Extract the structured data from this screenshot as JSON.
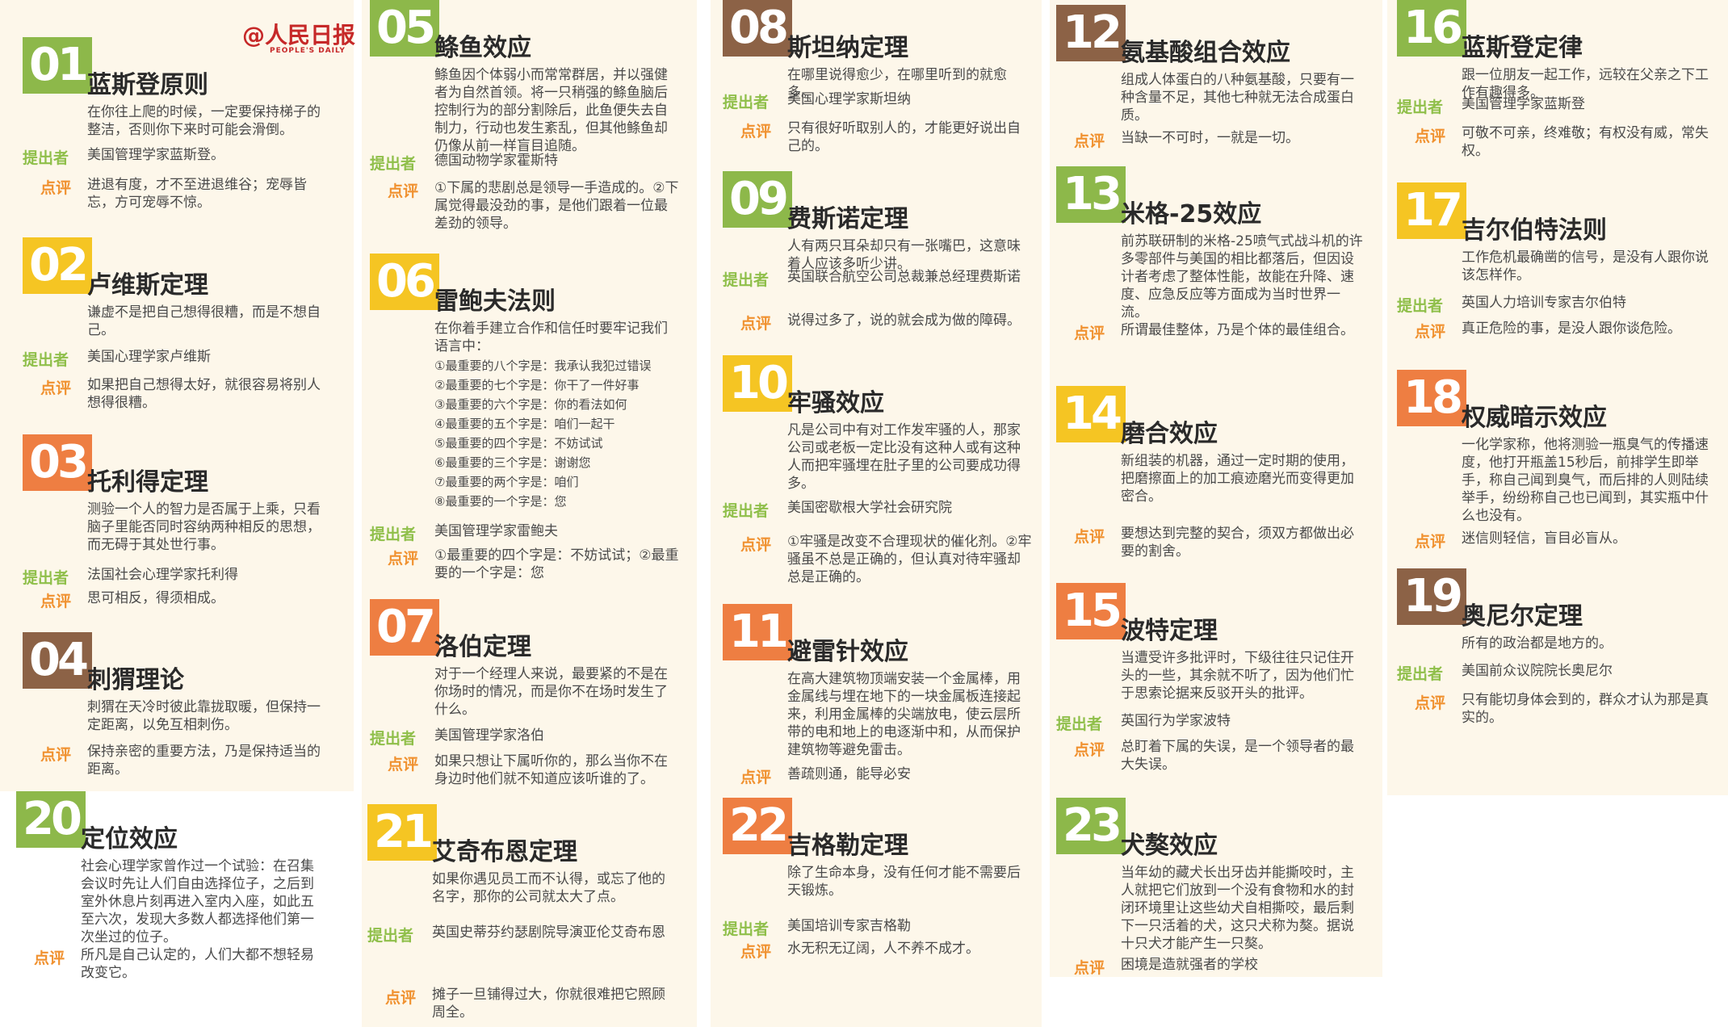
{
  "brand": {
    "logo": "@人民日报",
    "sub": "PEOPLE'S DAILY"
  },
  "colors": {
    "green": "#8db84a",
    "yellow": "#f5c523",
    "orange": "#ee7e42",
    "brown": "#8c6246",
    "label_orange": "#f0912f",
    "label_green": "#8fbf4a"
  },
  "labels": {
    "proposer": "提出者",
    "comment": "点评"
  },
  "laws": [
    {
      "num": "01",
      "title": "蓝斯登原则",
      "desc": "在你往上爬的时候，一定要保持梯子的整洁，否则你下来时可能会滑倒。",
      "proposer": "美国管理学家蓝斯登。",
      "comment": "进退有度，才不至进退维谷；宠辱皆忘，方可宠辱不惊。"
    },
    {
      "num": "02",
      "title": "卢维斯定理",
      "desc": "谦虚不是把自己想得很糟，而是不想自己。",
      "proposer": "美国心理学家卢维斯",
      "comment": "如果把自己想得太好，就很容易将别人想得很糟。"
    },
    {
      "num": "03",
      "title": "托利得定理",
      "desc": "测验一个人的智力是否属于上乘，只看脑子里能否同时容纳两种相反的思想，而无碍于其处世行事。",
      "proposer": "法国社会心理学家托利得",
      "comment": "思可相反，得须相成。"
    },
    {
      "num": "04",
      "title": "刺猬理论",
      "desc": "刺猬在天冷时彼此靠拢取暖，但保持一定距离，以免互相刺伤。",
      "proposer": "",
      "comment": "保持亲密的重要方法，乃是保持适当的距离。"
    },
    {
      "num": "05",
      "title": "鲦鱼效应",
      "desc": "鲦鱼因个体弱小而常常群居，并以强健者为自然首领。将一只稍强的鲦鱼脑后控制行为的部分割除后，此鱼便失去自制力，行动也发生紊乱，但其他鲦鱼却仍像从前一样盲目追随。",
      "proposer": "德国动物学家霍斯特",
      "comment": "①下属的悲剧总是领导一手造成的。②下属觉得最没劲的事，是他们跟着一位最差劲的领导。"
    },
    {
      "num": "06",
      "title": "雷鲍夫法则",
      "desc": "在你着手建立合作和信任时要牢记我们语言中：",
      "list": [
        "①最重要的八个字是：我承认我犯过错误",
        "②最重要的七个字是：你干了一件好事",
        "③最重要的六个字是：你的看法如何",
        "④最重要的五个字是：咱们一起干",
        "⑤最重要的四个字是：不妨试试",
        "⑥最重要的三个字是：谢谢您",
        "⑦最重要的两个字是：咱们",
        "⑧最重要的一个字是：您"
      ],
      "proposer": "美国管理学家雷鲍夫",
      "comment": "①最重要的四个字是：不妨试试；②最重要的一个字是：您"
    },
    {
      "num": "07",
      "title": "洛伯定理",
      "desc": "对于一个经理人来说，最要紧的不是在你场时的情况，而是你不在场时发生了什么。",
      "proposer": "美国管理学家洛伯",
      "comment": "如果只想让下属听你的，那么当你不在身边时他们就不知道应该听谁的了。"
    },
    {
      "num": "08",
      "title": "斯坦纳定理",
      "desc": "在哪里说得愈少，在哪里听到的就愈多。",
      "proposer": "美国心理学家斯坦纳",
      "comment": "只有很好听取别人的，才能更好说出自己的。"
    },
    {
      "num": "09",
      "title": "费斯诺定理",
      "desc": "人有两只耳朵却只有一张嘴巴，这意味着人应该多听少讲。",
      "proposer": "英国联合航空公司总裁兼总经理费斯诺",
      "comment": "说得过多了，说的就会成为做的障碍。"
    },
    {
      "num": "10",
      "title": "牢骚效应",
      "desc": "凡是公司中有对工作发牢骚的人，那家公司或老板一定比没有这种人或有这种人而把牢骚埋在肚子里的公司要成功得多。",
      "proposer": "美国密歇根大学社会研究院",
      "comment": "①牢骚是改变不合理现状的催化剂。②牢骚虽不总是正确的，但认真对待牢骚却总是正确的。"
    },
    {
      "num": "11",
      "title": "避雷针效应",
      "desc": "在高大建筑物顶端安装一个金属棒，用金属线与埋在地下的一块金属板连接起来，利用金属棒的尖端放电，使云层所带的电和地上的电逐渐中和，从而保护建筑物等避免雷击。",
      "proposer": "",
      "comment": "善疏则通，能导必安"
    },
    {
      "num": "12",
      "title": "氨基酸组合效应",
      "desc": "组成人体蛋白的八种氨基酸，只要有一种含量不足，其他七种就无法合成蛋白质。",
      "proposer": "",
      "comment": "当缺一不可时，一就是一切。"
    },
    {
      "num": "13",
      "title": "米格-25效应",
      "desc": "前苏联研制的米格-25喷气式战斗机的许多零部件与美国的相比都落后，但因设计者考虑了整体性能，故能在升降、速度、应急反应等方面成为当时世界一流。",
      "proposer": "",
      "comment": "所谓最佳整体，乃是个体的最佳组合。"
    },
    {
      "num": "14",
      "title": "磨合效应",
      "desc": "新组装的机器，通过一定时期的使用，把磨擦面上的加工痕迹磨光而变得更加密合。",
      "proposer": "",
      "comment": "要想达到完整的契合，须双方都做出必要的割舍。"
    },
    {
      "num": "15",
      "title": "波特定理",
      "desc": "当遭受许多批评时，下级往往只记住开头的一些，其余就不听了，因为他们忙于思索论据来反驳开头的批评。",
      "proposer": "英国行为学家波特",
      "comment": "总盯着下属的失误，是一个领导者的最大失误。"
    },
    {
      "num": "16",
      "title": "蓝斯登定律",
      "desc": "跟一位朋友一起工作，远较在父亲之下工作有趣得多。",
      "proposer": "美国管理学家蓝斯登",
      "comment": "可敬不可亲，终难敬；有权没有威，常失权。"
    },
    {
      "num": "17",
      "title": "吉尔伯特法则",
      "desc": "工作危机最确凿的信号，是没有人跟你说该怎样作。",
      "proposer": "英国人力培训专家吉尔伯特",
      "comment": "真正危险的事，是没人跟你谈危险。"
    },
    {
      "num": "18",
      "title": "权威暗示效应",
      "desc": "一化学家称，他将测验一瓶臭气的传播速度，他打开瓶盖15秒后，前排学生即举手，称自己闻到臭气，而后排的人则陆续举手，纷纷称自己也已闻到，其实瓶中什么也没有。",
      "proposer": "",
      "comment": "迷信则轻信，盲目必盲从。"
    },
    {
      "num": "19",
      "title": "奥尼尔定理",
      "desc": "所有的政治都是地方的。",
      "proposer": "美国前众议院院长奥尼尔",
      "comment": "只有能切身体会到的，群众才认为那是真实的。"
    },
    {
      "num": "20",
      "title": "定位效应",
      "desc": "社会心理学家曾作过一个试验：在召集会议时先让人们自由选择位子，之后到室外休息片刻再进入室内入座，如此五至六次，发现大多数人都选择他们第一次坐过的位子。",
      "proposer": "",
      "comment": "所凡是自己认定的，人们大都不想轻易改变它。"
    },
    {
      "num": "21",
      "title": "艾奇布恩定理",
      "desc": "如果你遇见员工而不认得，或忘了他的名字，那你的公司就太大了点。",
      "proposer": "英国史蒂芬约瑟剧院导演亚伦艾奇布恩",
      "comment": "摊子一旦铺得过大，你就很难把它照顾周全。"
    },
    {
      "num": "22",
      "title": "吉格勒定理",
      "desc": "除了生命本身，没有任何才能不需要后天锻炼。",
      "proposer": "美国培训专家吉格勒",
      "comment": "水无积无辽阔，人不养不成才。"
    },
    {
      "num": "23",
      "title": "犬獒效应",
      "desc": "当年幼的藏犬长出牙齿并能撕咬时，主人就把它们放到一个没有食物和水的封闭环境里让这些幼犬自相撕咬，最后剩下一只活着的犬，这只犬称为獒。据说十只犬才能产生一只獒。",
      "proposer": "",
      "comment": "困境是造就强者的学校"
    }
  ]
}
